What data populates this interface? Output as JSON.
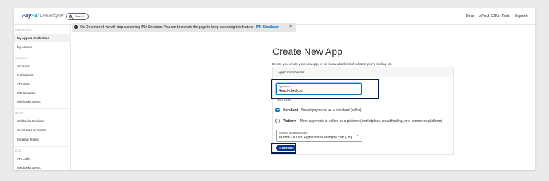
{
  "brand": {
    "pay": "Pay",
    "pal": "Pal",
    "dev": "Developer"
  },
  "search": {
    "label": "Search"
  },
  "nav": {
    "docs": "Docs",
    "apis": "APIs & SDKs",
    "tools": "Tools",
    "support": "Support"
  },
  "sidebar": {
    "dashboard_head": "DASHBOARD",
    "my_apps": "My Apps & Credentials",
    "my_account": "My Account",
    "sandbox_head": "SANDBOX",
    "accounts": "Accounts",
    "notifications": "Notifications",
    "api_calls": "API Calls",
    "ipn_simulator": "IPN Simulator",
    "webhooks_events": "Webhooks Events",
    "mock_head": "MOCK",
    "webhooks_simulator": "Webhooks Simulator",
    "credit_card_generator": "Credit Card Generator",
    "negative_testing": "Negative Testing",
    "live_head": "LIVE",
    "live_api_calls": "API Calls",
    "live_webhooks_events": "Webhooks Events"
  },
  "banner": {
    "text": "On December 8 we will stop supporting IPN Simulator. You can bookmark the page to keep accessing this feature.",
    "link": "IPN Simulator",
    "close": "✕",
    "info": "!"
  },
  "main": {
    "title": "Create New App",
    "subtitle": "Before you create your new app, let us know what kind of solution you're looking for.",
    "card_title": "Application Details",
    "app_name_label": "App Name",
    "app_name_value": "React-checkout",
    "app_type_label": "App Type",
    "merchant_label": "Merchant",
    "merchant_desc": " - Accept payments as a merchant (seller)",
    "platform_label": "Platform",
    "platform_desc": " - Move payments to sellers as a platform (marketplace, crowdfunding, or e-commerce platform)",
    "sandbox_label": "Sandbox Business Account",
    "sandbox_value": "sb-c89z21001914@business.example.com (US)",
    "caret": "⌄",
    "create_button": "Create App"
  },
  "colors": {
    "accent": "#0070ba",
    "primary_button": "#003087"
  }
}
